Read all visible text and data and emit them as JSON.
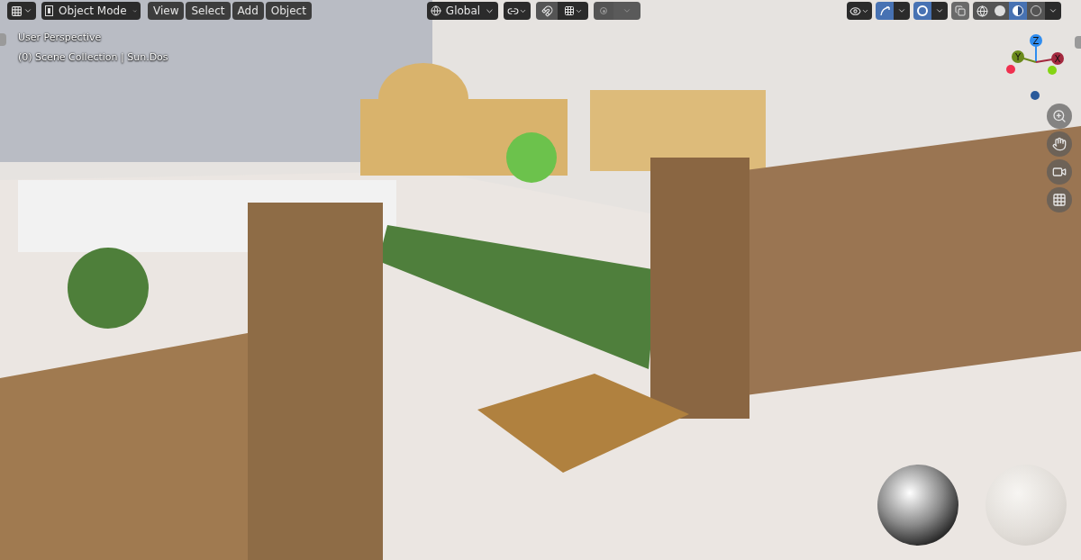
{
  "header": {
    "mode": "Object Mode",
    "menus": [
      "View",
      "Select",
      "Add",
      "Object"
    ],
    "transform_orientation": "Global",
    "snap": {
      "on": false
    },
    "proportional_editing": {
      "on": false
    },
    "visibility_toggle": {
      "on": false
    },
    "gizmo_toggle": {
      "on": true
    },
    "overlay_toggle": {
      "on": true
    },
    "xray_toggle": {
      "on": false
    },
    "shading_modes": [
      {
        "kind": "wireframe",
        "selected": false
      },
      {
        "kind": "solid",
        "selected": false
      },
      {
        "kind": "material",
        "selected": true
      },
      {
        "kind": "rendered",
        "selected": false
      }
    ]
  },
  "viewport": {
    "info": [
      "User Perspective",
      "(0) Scene Collection | Sun.Dos"
    ],
    "axes": [
      {
        "label": "Z",
        "color": "#2f8df0"
      },
      {
        "label": "Y",
        "color": "#6b8a1c"
      },
      {
        "label": "X",
        "color": "#a3283e"
      }
    ]
  }
}
